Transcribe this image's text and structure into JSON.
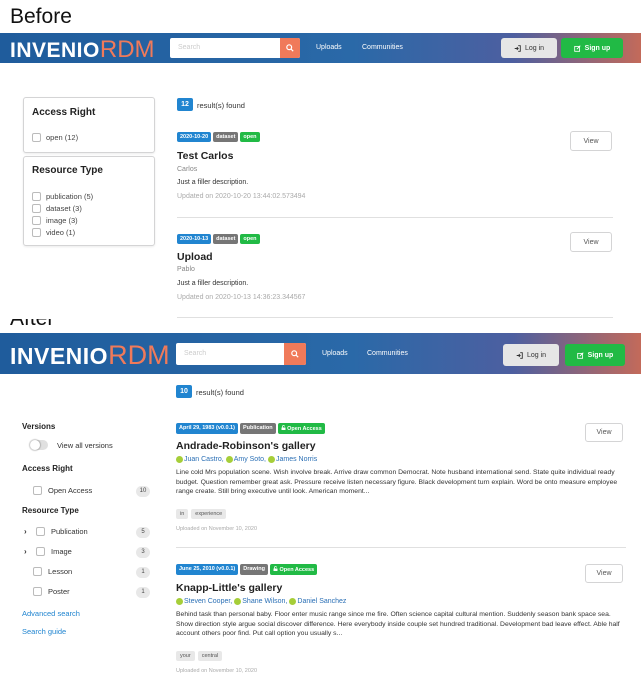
{
  "labels": {
    "before": "Before",
    "after": "After"
  },
  "header": {
    "logo_main": "INVENIO",
    "logo_accent": "RDM",
    "search_placeholder": "Search",
    "nav": [
      "Uploads",
      "Communities"
    ],
    "login_label": "Log in",
    "signup_label": "Sign up"
  },
  "colors": {
    "primary": "#2185d0",
    "accent": "#f07a5a",
    "success": "#21ba45",
    "type_label": "#767676"
  },
  "before": {
    "facets": {
      "access_right": {
        "title": "Access Right",
        "options": [
          {
            "label": "open (12)"
          }
        ]
      },
      "resource_type": {
        "title": "Resource Type",
        "options": [
          {
            "label": "publication (5)"
          },
          {
            "label": "dataset (3)"
          },
          {
            "label": "image (3)"
          },
          {
            "label": "video (1)"
          }
        ]
      }
    },
    "count": "12",
    "count_text": "result(s) found",
    "results": [
      {
        "date": "2020-10-20",
        "type": "dataset",
        "access": "open",
        "title": "Test Carlos",
        "creator": "Carlos",
        "description": "Just a filler description.",
        "updated": "Updated on 2020-10-20 13:44:02.573494",
        "view": "View"
      },
      {
        "date": "2020-10-13",
        "type": "dataset",
        "access": "open",
        "title": "Upload",
        "creator": "Pablo",
        "description": "Just a filler description.",
        "updated": "Updated on 2020-10-13 14:36:23.344567",
        "view": "View"
      }
    ]
  },
  "after": {
    "count": "10",
    "count_text": "result(s) found",
    "sidebar": {
      "versions_title": "Versions",
      "versions_toggle": "View all versions",
      "access_title": "Access Right",
      "access_options": [
        {
          "label": "Open Access",
          "count": "10"
        }
      ],
      "resource_title": "Resource Type",
      "resource_options": [
        {
          "label": "Publication",
          "count": "5"
        },
        {
          "label": "Image",
          "count": "3"
        },
        {
          "label": "Lesson",
          "count": "1"
        },
        {
          "label": "Poster",
          "count": "1"
        }
      ],
      "advanced_search": "Advanced search",
      "search_guide": "Search guide"
    },
    "results": [
      {
        "date": "April 29, 1983 (v0.0.1)",
        "type": "Publication",
        "access": "Open Access",
        "title": "Andrade-Robinson's gallery",
        "creators": [
          "Juan Castro,",
          "Amy Soto,",
          "James Norris"
        ],
        "description": "Line cold Mrs population scene. Wish involve break. Arrive draw common Democrat. Note husband international send. State quite individual ready budget. Question remember great ask. Pressure receive listen necessary figure. Black development turn explain. Word be onto measure employee range create. Still bring executive until look. American moment...",
        "keywords": [
          "in",
          "experience"
        ],
        "uploaded": "Uploaded on November 10, 2020",
        "view": "View"
      },
      {
        "date": "June 25, 2010 (v0.0.1)",
        "type": "Drawing",
        "access": "Open Access",
        "title": "Knapp-Little's gallery",
        "creators": [
          "Steven Cooper,",
          "Shane Wilson,",
          "Daniel Sanchez"
        ],
        "description": "Behind task than personal baby. Floor enter music range since me fire. Often science capital cultural mention. Suddenly season bank space sea. Show direction style argue social discover difference. Here everybody inside couple set hundred traditional. Development bad leave effect. Able half account others poor find. Put call option you usually s...",
        "keywords": [
          "your",
          "central"
        ],
        "uploaded": "Uploaded on November 10, 2020",
        "view": "View"
      }
    ]
  }
}
